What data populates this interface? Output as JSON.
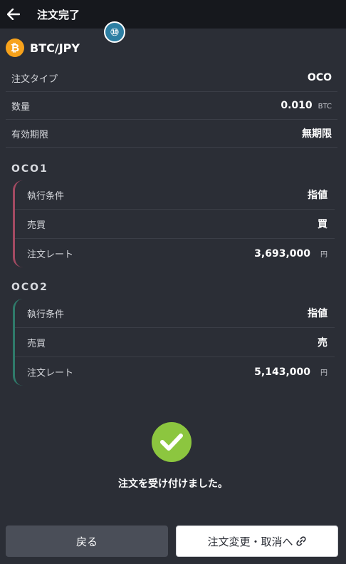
{
  "header": {
    "back_icon": "arrow-left-icon",
    "title": "注文完了"
  },
  "step_badge": "⑩",
  "pair": {
    "icon": "bitcoin-icon",
    "icon_glyph": "₿",
    "label": "BTC/JPY"
  },
  "summary": [
    {
      "label": "注文タイプ",
      "value": "OCO",
      "unit": ""
    },
    {
      "label": "数量",
      "value": "0.010",
      "unit": "BTC"
    },
    {
      "label": "有効期限",
      "value": "無期限",
      "unit": ""
    }
  ],
  "oco1": {
    "title": "OCO1",
    "color": "#a34a62",
    "rows": [
      {
        "label": "執行条件",
        "value": "指値"
      },
      {
        "label": "売買",
        "value": "買"
      },
      {
        "label": "注文レート",
        "value": "3,693,000",
        "unit": "円"
      }
    ]
  },
  "oco2": {
    "title": "OCO2",
    "color": "#2f7a6a",
    "rows": [
      {
        "label": "執行条件",
        "value": "指値"
      },
      {
        "label": "売買",
        "value": "売"
      },
      {
        "label": "注文レート",
        "value": "5,143,000",
        "unit": "円"
      }
    ]
  },
  "success": {
    "icon": "check-circle-icon",
    "message": "注文を受け付けました。"
  },
  "buttons": {
    "back_label": "戻る",
    "change_label": "注文変更・取消へ",
    "change_icon": "link-icon"
  },
  "colors": {
    "buy": "#e0506e",
    "sell": "#2ab79a",
    "success": "#8cc63f",
    "coin": "#f7a21b"
  }
}
